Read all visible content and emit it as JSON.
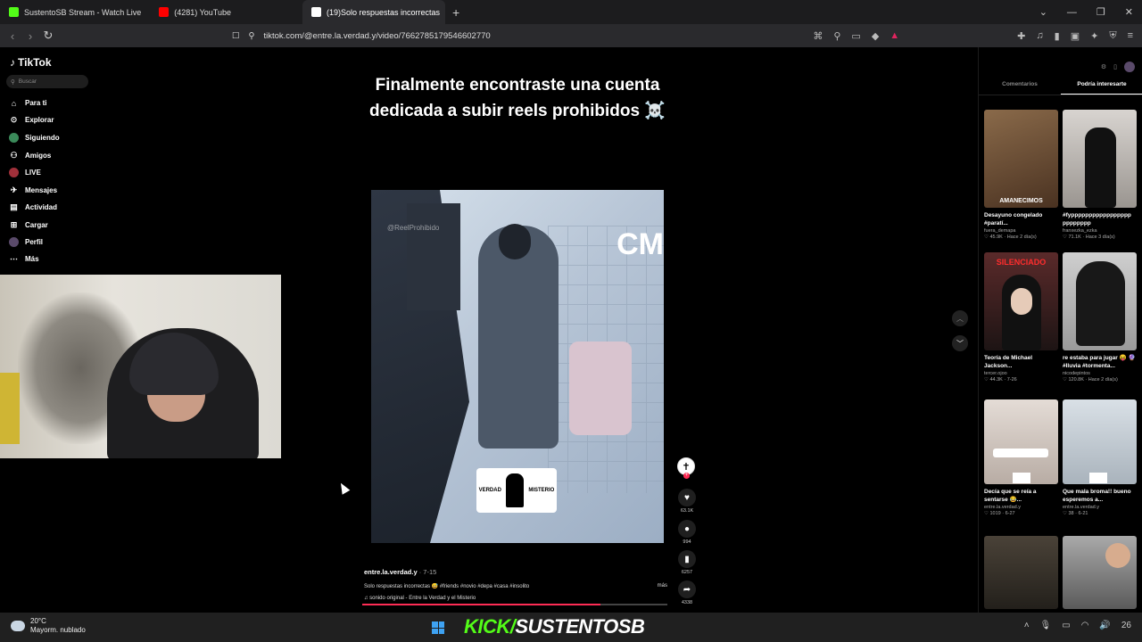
{
  "browser": {
    "tabs": [
      {
        "label": "SustentoSB Stream - Watch Live",
        "color": "#53fc18",
        "active": false
      },
      {
        "label": "(4281) YouTube",
        "color": "#ff0000",
        "active": false
      },
      {
        "label": "(19)Solo respuestas incorrectas",
        "color": "#ffffff",
        "active": true
      }
    ],
    "url": "tiktok.com/@entre.la.verdad.y/video/7662785179546602770"
  },
  "tiktok": {
    "logo": "TikTok",
    "search_placeholder": "Buscar",
    "nav": [
      {
        "label": "Para ti",
        "icon": "home-icon"
      },
      {
        "label": "Explorar",
        "icon": "compass-icon"
      },
      {
        "label": "Siguiendo",
        "icon": "following-icon"
      },
      {
        "label": "Amigos",
        "icon": "friends-icon"
      },
      {
        "label": "LIVE",
        "icon": "live-icon"
      },
      {
        "label": "Mensajes",
        "icon": "messages-icon"
      },
      {
        "label": "Actividad",
        "icon": "activity-icon"
      },
      {
        "label": "Cargar",
        "icon": "upload-icon"
      },
      {
        "label": "Perfil",
        "icon": "profile-icon"
      },
      {
        "label": "Más",
        "icon": "more-icon"
      }
    ]
  },
  "video": {
    "caption": "Finalmente encontraste una cuenta dedicada a subir reels prohibidos ☠️",
    "overlay_text": "CM",
    "watermark": "@ReelProhibido",
    "logo_left": "VERDAD",
    "logo_right": "MISTERIO",
    "author": "entre.la.verdad.y",
    "date": "· 7-15",
    "description": "Solo respuestas incorrectas 😅 #friends #novio #depa #casa #insolito",
    "more": "más",
    "music": "♫ sonido original - Entre la Verdad y el Misterio",
    "progress": 0.78,
    "likes": "63.1K",
    "comments": "994",
    "saves": "6257",
    "shares": "4338"
  },
  "right_panel": {
    "tabs": [
      "Comentarios",
      "Podría interesarte"
    ],
    "cards": [
      {
        "title": "Desayuno congelado #paratí...",
        "author": "fuera_demapa",
        "meta": "♡ 45.9K · Hace 2 día(s)",
        "label": "AMANECIMOS",
        "bg": "#6b4a33"
      },
      {
        "title": "#fyppppppppppppppppp pppppppp",
        "author": "franxezka_ezka",
        "meta": "♡ 71.1K · Hace 3 día(s)",
        "label": "",
        "bg": "#c8c4c0"
      },
      {
        "title": "Teoría de Michael Jackson...",
        "author": "tercer.ojoo",
        "meta": "♡ 44.3K · 7-26",
        "label": "SILENCIADO",
        "bg": "#3a2a2a"
      },
      {
        "title": "re estaba para jugar 😝 🔮 #lluvia #tormenta...",
        "author": "nicodepintos",
        "meta": "♡ 120.8K · Hace 2 día(s)",
        "label": "",
        "bg": "#b9b9b9"
      },
      {
        "title": "Decía que se reía a sentarse 😂...",
        "author": "entre.la.verdad.y",
        "meta": "♡ 1019 · 6-27",
        "label": "",
        "bg": "#d8cfc9"
      },
      {
        "title": "Que mala broma!! bueno esperemos a...",
        "author": "entre.la.verdad.y",
        "meta": "♡ 38 · 6-21",
        "label": "",
        "bg": "#bcc6cf"
      },
      {
        "title": "",
        "author": "",
        "meta": "",
        "label": "",
        "bg": "#3d3830"
      },
      {
        "title": "",
        "author": "",
        "meta": "",
        "label": "",
        "bg": "#8a8a8a"
      }
    ]
  },
  "stream_overlay": {
    "brand": "KICK/",
    "channel": "SUSTENTOSB"
  },
  "taskbar": {
    "temperature": "20°C",
    "weather": "Mayorm. nublado",
    "clock": "26"
  }
}
